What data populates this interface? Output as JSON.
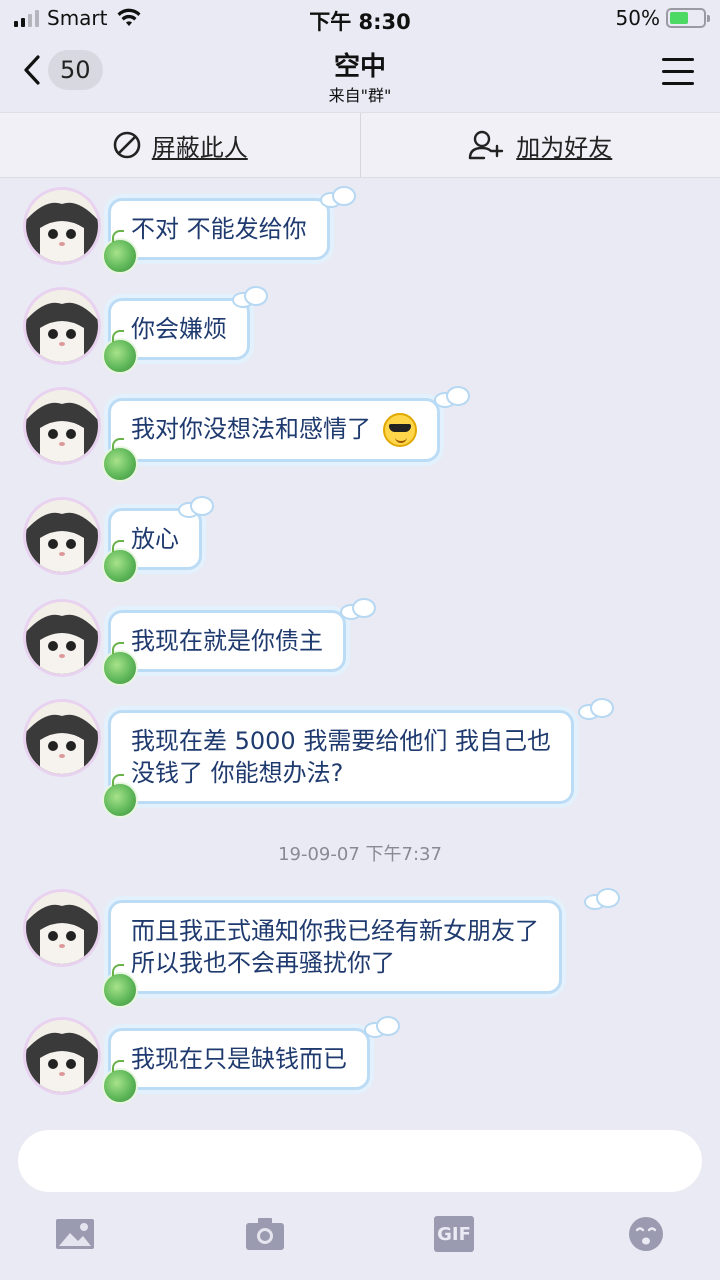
{
  "status_bar": {
    "carrier": "Smart",
    "time": "下午 8:30",
    "battery": "50%",
    "battery_level": 0.5
  },
  "nav": {
    "back_count": "50",
    "title": "空中",
    "subtitle": "来自\"群\""
  },
  "actions": {
    "block_label": "屏蔽此人",
    "add_friend_label": "加为好友"
  },
  "messages": [
    {
      "text": "不对 不能发给你"
    },
    {
      "text": "你会嫌烦"
    },
    {
      "text": "我对你没想法和感情了",
      "emoji": "cool-sunglasses-emoji"
    },
    {
      "text": "放心"
    },
    {
      "text": "我现在就是你债主"
    },
    {
      "line1": "我现在差 5000 我需要给他们 我自己也",
      "line2": "没钱了 你能想办法?"
    },
    {
      "line1": "而且我正式通知你我已经有新女朋友了",
      "line2": "所以我也不会再骚扰你了"
    },
    {
      "text": "我现在只是缺钱而已"
    }
  ],
  "timestamp": "19-09-07 下午7:37",
  "composer": {
    "input_value": "",
    "tools": [
      "image-icon",
      "camera-icon",
      "gif-icon",
      "emoji-icon"
    ],
    "gif_label": "GIF"
  },
  "colors": {
    "background": "#eaeaf4",
    "bubble_border": "#bcdcf6",
    "bubble_text": "#1f3a6e",
    "tool_gray": "#9a9ab0"
  }
}
